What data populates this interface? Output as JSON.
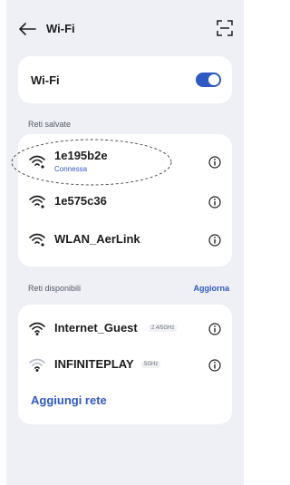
{
  "header": {
    "title": "Wi-Fi",
    "back_icon": "arrow-left-icon",
    "scan_icon": "qr-scan-icon"
  },
  "wifi_toggle": {
    "label": "Wi-Fi",
    "state": "on",
    "color": "#2f59c4"
  },
  "saved": {
    "section_label": "Reti salvate",
    "networks": [
      {
        "ssid": "1e195b2e",
        "status": "Connessa"
      },
      {
        "ssid": "1e575c36"
      },
      {
        "ssid": "WLAN_AerLink"
      }
    ]
  },
  "available": {
    "section_label": "Reti disponibili",
    "refresh_label": "Aggiorna",
    "networks": [
      {
        "ssid": "Internet_Guest",
        "band": "2.4/5GHz"
      },
      {
        "ssid": "INFINITEPLAY",
        "band": "5GHz"
      }
    ],
    "add_label": "Aggiungi rete"
  },
  "colors": {
    "accent": "#2f59c4",
    "background": "#eef0f5",
    "card": "#ffffff"
  }
}
